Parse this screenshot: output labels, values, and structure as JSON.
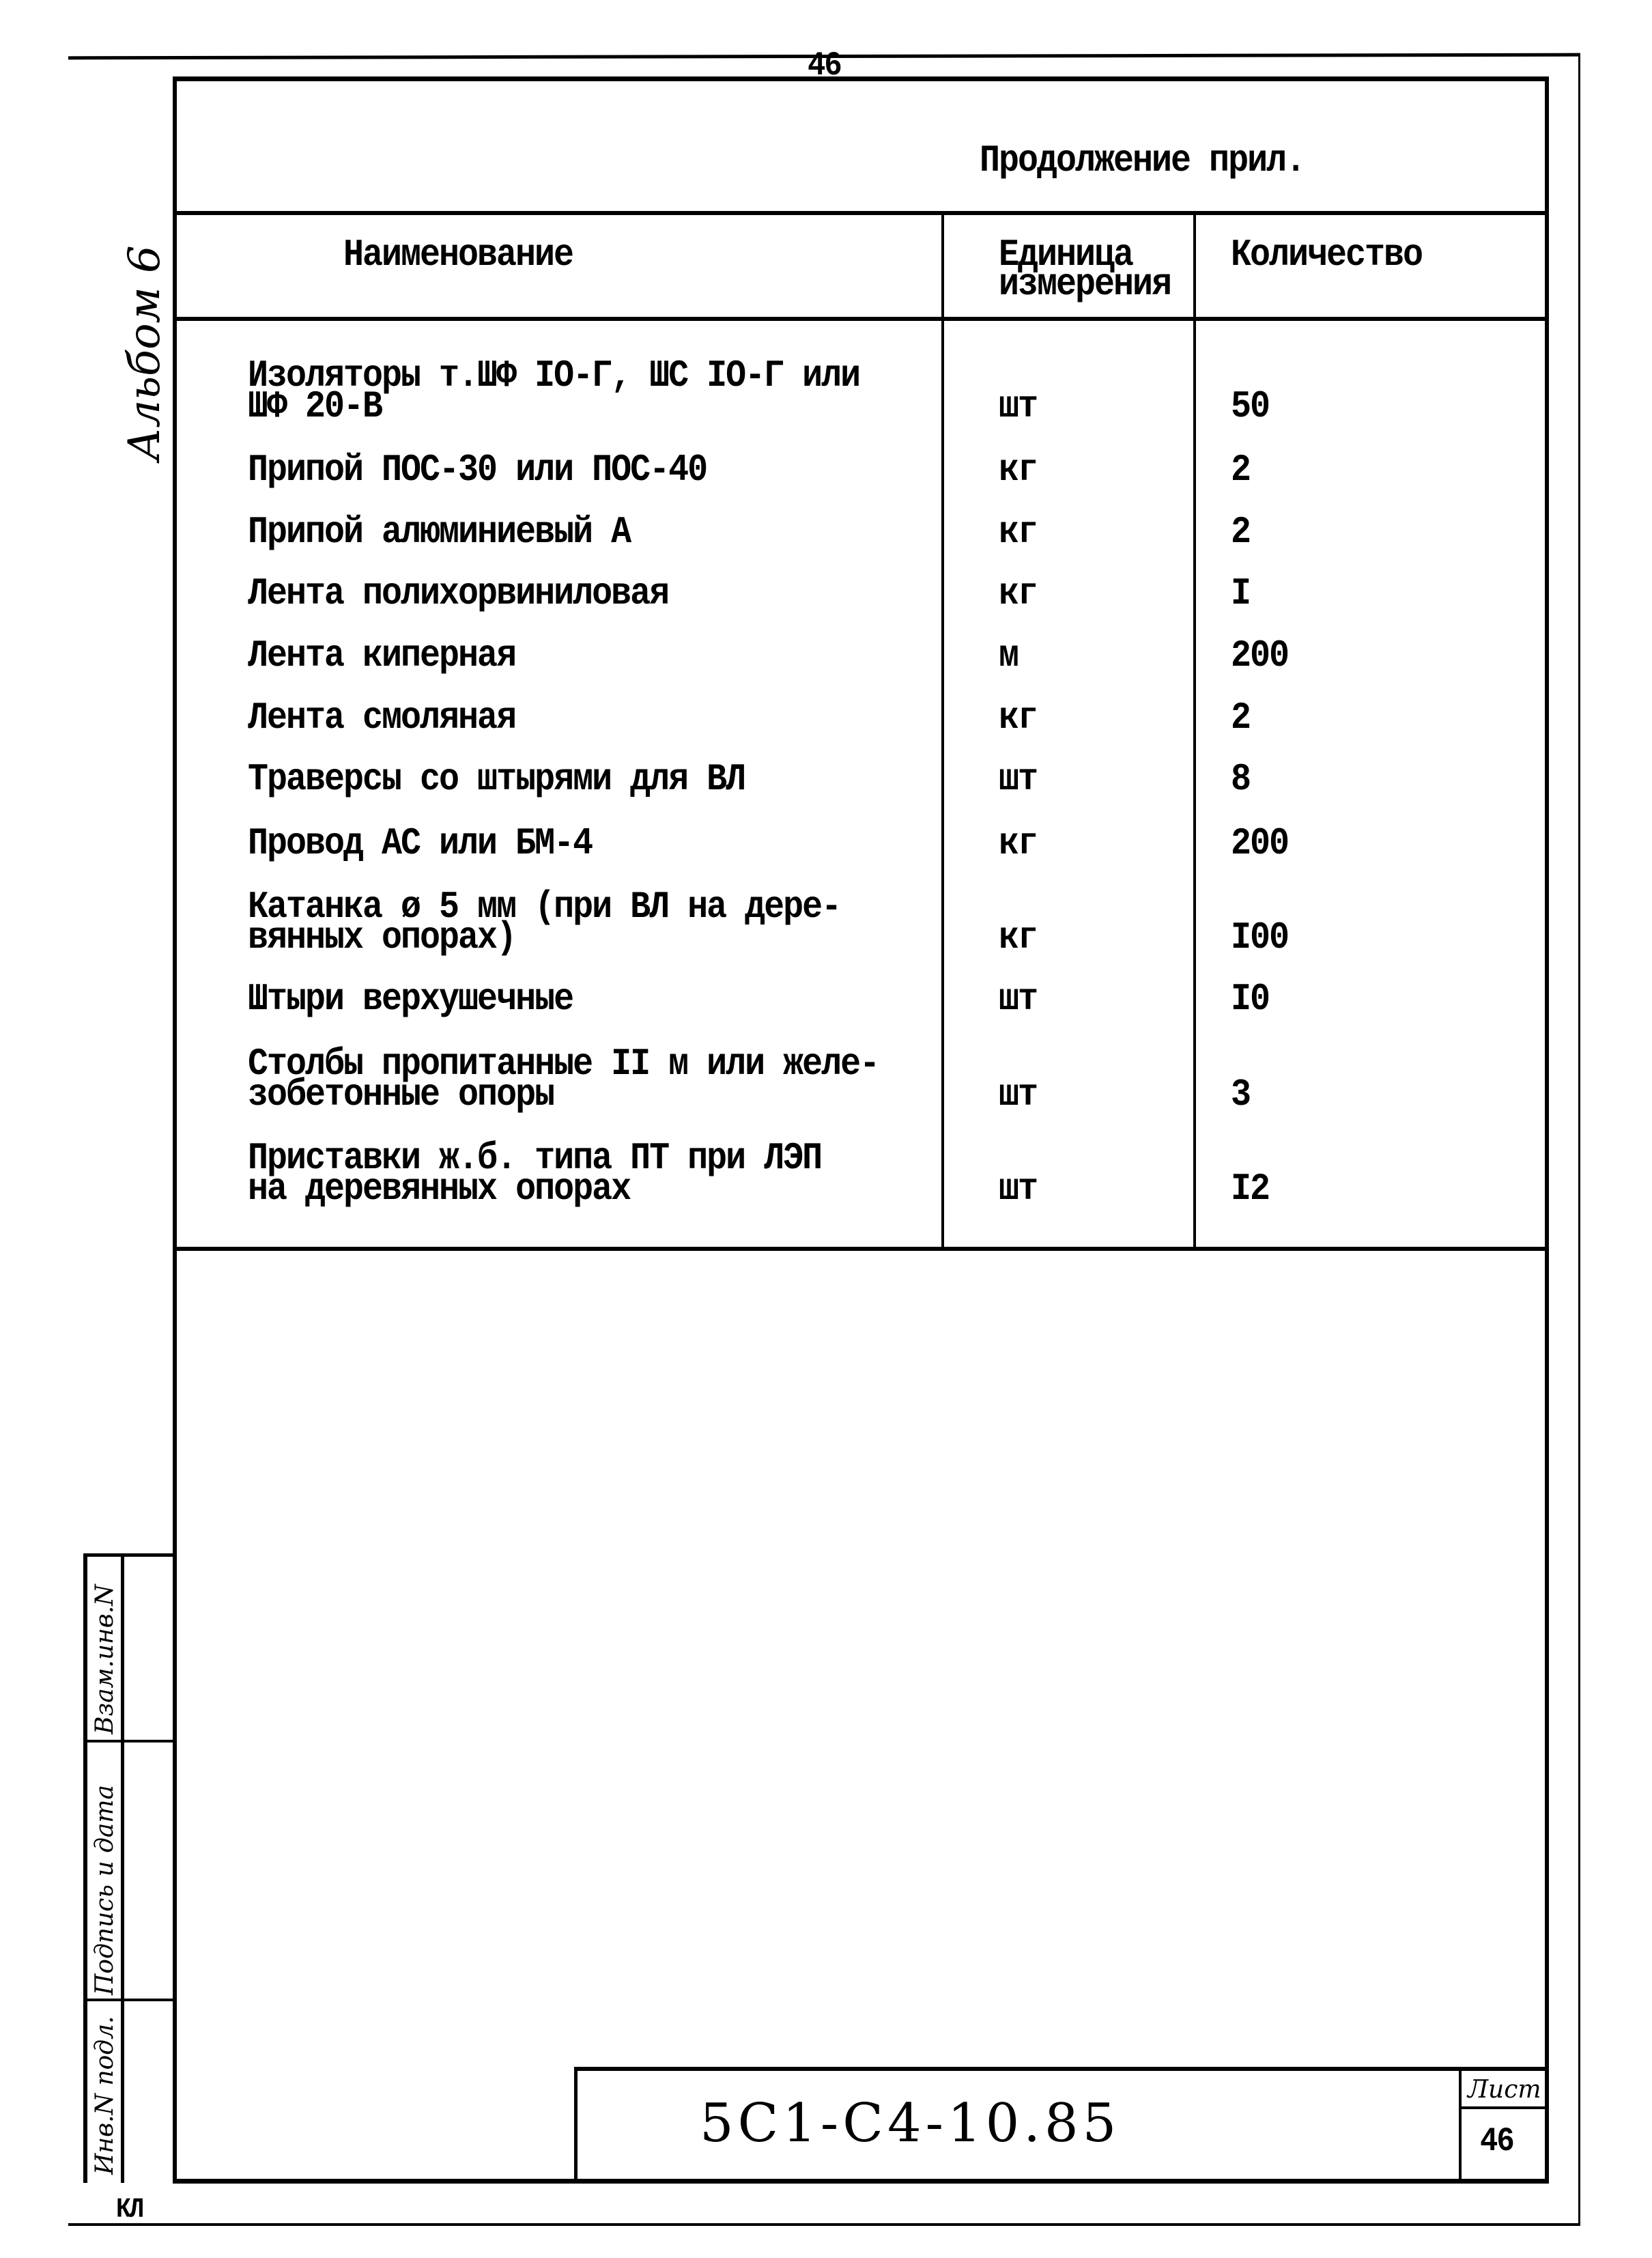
{
  "page": {
    "top_page_number": "46",
    "continuation_title": "Продолжение прил.",
    "album_label": "Альбом 6",
    "bottom_left_mark": "КЛ"
  },
  "table": {
    "headers": {
      "name": "Наименование",
      "unit_line1": "Единица",
      "unit_line2": "измерения",
      "quantity": "Количество"
    },
    "rows": [
      {
        "name": [
          "Изоляторы т.ШФ IO-Г, ШС IO-Г или",
          "ШФ 20-В"
        ],
        "unit": "шт",
        "qty": "50"
      },
      {
        "name": [
          "Припой ПОС-30 или ПОС-40"
        ],
        "unit": "кг",
        "qty": "2"
      },
      {
        "name": [
          "Припой алюминиевый А"
        ],
        "unit": "кг",
        "qty": "2"
      },
      {
        "name": [
          "Лента полихорвиниловая"
        ],
        "unit": "кг",
        "qty": "I"
      },
      {
        "name": [
          "Лента киперная"
        ],
        "unit": "м",
        "qty": "200"
      },
      {
        "name": [
          "Лента смоляная"
        ],
        "unit": "кг",
        "qty": "2"
      },
      {
        "name": [
          "Траверсы со штырями для ВЛ"
        ],
        "unit": "шт",
        "qty": "8"
      },
      {
        "name": [
          "Провод АС или БМ-4"
        ],
        "unit": "кг",
        "qty": "200"
      },
      {
        "name": [
          "Катанка ø 5 мм (при ВЛ на дере-",
          "вянных опорах)"
        ],
        "unit": "кг",
        "qty": "I00"
      },
      {
        "name": [
          "Штыри верхушечные"
        ],
        "unit": "шт",
        "qty": "I0"
      },
      {
        "name": [
          "Столбы пропитанные II м или желе-",
          "зобетонные опоры"
        ],
        "unit": "шт",
        "qty": "3"
      },
      {
        "name": [
          "Приставки ж.б. типа ПТ при ЛЭП",
          "на деревянных опорах"
        ],
        "unit": "шт",
        "qty": "I2"
      }
    ]
  },
  "side_stamp": {
    "labels": [
      "Взам.инв.N",
      "Подпись и дата",
      "Инв.N подл."
    ]
  },
  "title_block": {
    "document_code": "5С1-С4-10.85",
    "sheet_label": "Лист",
    "sheet_number": "46"
  }
}
